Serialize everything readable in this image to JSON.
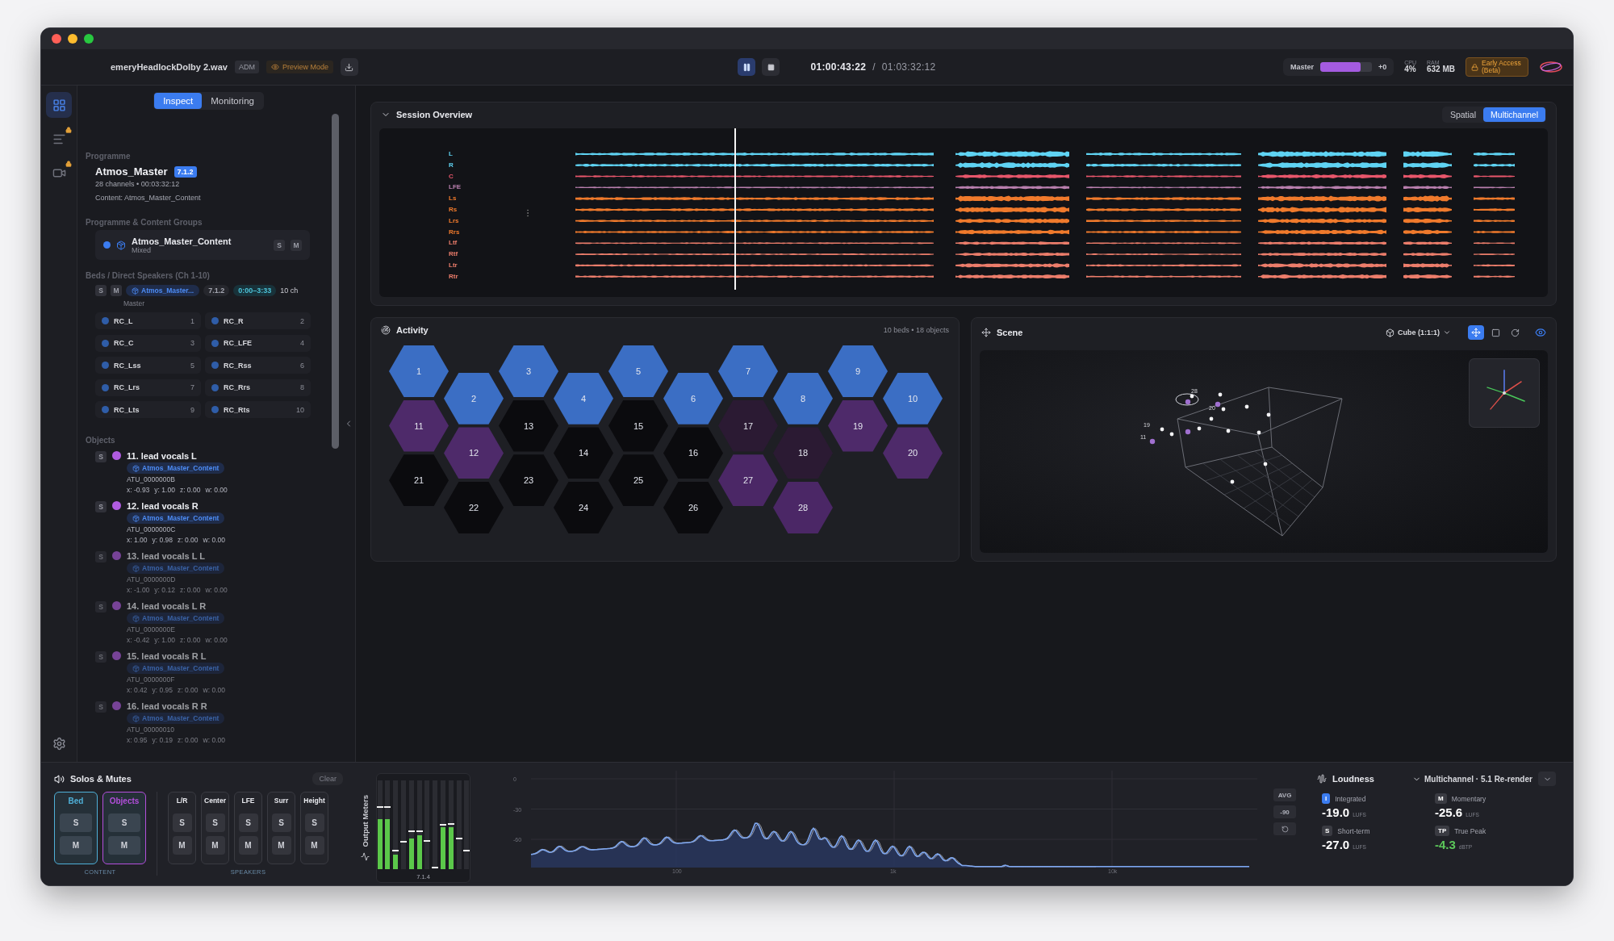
{
  "toolbar": {
    "filename": "emeryHeadlockDolby 2.wav",
    "format": "ADM",
    "mode": "Preview Mode",
    "playing": true,
    "timecode": "01:00:43:22",
    "separator": "/",
    "duration": "01:03:32:12",
    "master": {
      "label": "Master",
      "level": 0.78,
      "gain": "+0"
    },
    "stats": [
      {
        "label": "CPU",
        "value": "4%"
      },
      {
        "label": "RAM",
        "value": "632 MB"
      }
    ],
    "badge": "Early Access (Beta)"
  },
  "rail": [
    {
      "kind": "grid",
      "selected": true,
      "locked": false
    },
    {
      "kind": "list",
      "selected": false,
      "locked": true
    },
    {
      "kind": "video",
      "selected": false,
      "locked": true
    }
  ],
  "panel": {
    "tabs": [
      {
        "label": "Inspect",
        "selected": true
      },
      {
        "label": "Monitoring",
        "selected": false
      }
    ],
    "programme": {
      "heading": "Programme",
      "name": "Atmos_Master",
      "format": "7.1.2",
      "info": "28 channels • 00:03:32:12",
      "content": "Content: Atmos_Master_Content"
    },
    "groups": {
      "heading": "Programme & Content Groups",
      "name": "Atmos_Master_Content",
      "mix": "Mixed",
      "solo": "S",
      "mute": "M"
    },
    "beds": {
      "heading": "Beds / Direct Speakers (Ch 1-10)",
      "solo": "S",
      "mute": "M",
      "group": "Atmos_Master...",
      "format": "7.1.2",
      "range": "0:00–3:33",
      "count": "10 ch",
      "name": "Master",
      "channels": [
        {
          "name": "RC_L",
          "number": "1"
        },
        {
          "name": "RC_R",
          "number": "2"
        },
        {
          "name": "RC_C",
          "number": "3"
        },
        {
          "name": "RC_LFE",
          "number": "4"
        },
        {
          "name": "RC_Lss",
          "number": "5"
        },
        {
          "name": "RC_Rss",
          "number": "6"
        },
        {
          "name": "RC_Lrs",
          "number": "7"
        },
        {
          "name": "RC_Rrs",
          "number": "8"
        },
        {
          "name": "RC_Lts",
          "number": "9"
        },
        {
          "name": "RC_Rts",
          "number": "10"
        }
      ]
    },
    "objects_heading": "Objects",
    "objects": [
      {
        "solo": "S",
        "title": "11. lead vocals L",
        "group": "Atmos_Master_Content",
        "id": "ATU_0000000B",
        "coords": [
          "x: -0.93",
          "y: 1.00",
          "z: 0.00",
          "w: 0.00"
        ],
        "active": true
      },
      {
        "solo": "S",
        "title": "12. lead vocals R",
        "group": "Atmos_Master_Content",
        "id": "ATU_0000000C",
        "coords": [
          "x: 1.00",
          "y: 0.98",
          "z: 0.00",
          "w: 0.00"
        ],
        "active": true
      },
      {
        "solo": "S",
        "title": "13. lead vocals L L",
        "group": "Atmos_Master_Content",
        "id": "ATU_0000000D",
        "coords": [
          "x: -1.00",
          "y: 0.12",
          "z: 0.00",
          "w: 0.00"
        ],
        "active": false
      },
      {
        "solo": "S",
        "title": "14. lead vocals L R",
        "group": "Atmos_Master_Content",
        "id": "ATU_0000000E",
        "coords": [
          "x: -0.42",
          "y: 1.00",
          "z: 0.00",
          "w: 0.00"
        ],
        "active": false
      },
      {
        "solo": "S",
        "title": "15. lead vocals R L",
        "group": "Atmos_Master_Content",
        "id": "ATU_0000000F",
        "coords": [
          "x: 0.42",
          "y: 0.95",
          "z: 0.00",
          "w: 0.00"
        ],
        "active": false
      },
      {
        "solo": "S",
        "title": "16. lead vocals R R",
        "group": "Atmos_Master_Content",
        "id": "ATU_00000010",
        "coords": [
          "x: 0.95",
          "y: 0.19",
          "z: 0.00",
          "w: 0.00"
        ],
        "active": false
      }
    ]
  },
  "session": {
    "title": "Session Overview",
    "views": [
      {
        "label": "Spatial",
        "selected": false
      },
      {
        "label": "Multichannel",
        "selected": true
      }
    ],
    "playback_position": {
      "level": 0.2
    },
    "channels": [
      {
        "label": "L",
        "color": "#5fd3f3"
      },
      {
        "label": "R",
        "color": "#5fd3f3"
      },
      {
        "label": "C",
        "color": "#e8566b"
      },
      {
        "label": "LFE",
        "color": "#b97fae"
      },
      {
        "label": "Ls",
        "color": "#f07a2c"
      },
      {
        "label": "Rs",
        "color": "#f07a2c"
      },
      {
        "label": "Lrs",
        "color": "#f07a2c"
      },
      {
        "label": "Rrs",
        "color": "#f07a2c"
      },
      {
        "label": "Ltf",
        "color": "#ec7d6b"
      },
      {
        "label": "Rtf",
        "color": "#ec7d6b"
      },
      {
        "label": "Ltr",
        "color": "#ec7d6b"
      },
      {
        "label": "Rtr",
        "color": "#ec7d6b"
      }
    ]
  },
  "activity": {
    "title": "Activity",
    "summary": "10 beds • 18 objects",
    "cells": [
      {
        "label": "1",
        "color": "#3b6ec4"
      },
      {
        "label": "2",
        "color": "#3b6ec4"
      },
      {
        "label": "3",
        "color": "#3b6ec4"
      },
      {
        "label": "4",
        "color": "#3b6ec4"
      },
      {
        "label": "5",
        "color": "#3b6ec4"
      },
      {
        "label": "6",
        "color": "#3b6ec4"
      },
      {
        "label": "7",
        "color": "#3b6ec4"
      },
      {
        "label": "8",
        "color": "#3b6ec4"
      },
      {
        "label": "9",
        "color": "#3b6ec4"
      },
      {
        "label": "10",
        "color": "#3b6ec4"
      },
      {
        "label": "11",
        "color": "#4e2a6a"
      },
      {
        "label": "12",
        "color": "#4e2a6a"
      },
      {
        "label": "13",
        "color": "#0b0b0e"
      },
      {
        "label": "14",
        "color": "#0b0b0e"
      },
      {
        "label": "15",
        "color": "#0b0b0e"
      },
      {
        "label": "16",
        "color": "#0b0b0e"
      },
      {
        "label": "17",
        "color": "#2b1a33"
      },
      {
        "label": "18",
        "color": "#2b1a33"
      },
      {
        "label": "19",
        "color": "#4e2a6a"
      },
      {
        "label": "20",
        "color": "#4e2a6a"
      },
      {
        "label": "21",
        "color": "#0b0b0e"
      },
      {
        "label": "22",
        "color": "#0b0b0e"
      },
      {
        "label": "23",
        "color": "#0b0b0e"
      },
      {
        "label": "24",
        "color": "#0b0b0e"
      },
      {
        "label": "25",
        "color": "#0b0b0e"
      },
      {
        "label": "26",
        "color": "#0b0b0e"
      },
      {
        "label": "27",
        "color": "#4b2766"
      },
      {
        "label": "28",
        "color": "#4b2766"
      }
    ]
  },
  "scene": {
    "title": "Scene",
    "view": "Cube (1:1:1)",
    "tools": [
      {
        "kind": "move",
        "selected": true
      },
      {
        "kind": "frame",
        "selected": false
      },
      {
        "kind": "rotate",
        "selected": false
      }
    ],
    "visible": true,
    "point_labels": [
      "28",
      "20",
      "19",
      "11"
    ]
  },
  "solos": {
    "title": "Solos & Mutes",
    "clear": "Clear",
    "content": [
      {
        "label": "Bed",
        "color": "#4fb0d8",
        "solo": "S",
        "mute": "M"
      },
      {
        "label": "Objects",
        "color": "#b34fdc",
        "solo": "S",
        "mute": "M"
      }
    ],
    "content_caption": "CONTENT",
    "speakers": [
      {
        "label": "L/R",
        "solo": "S",
        "mute": "M"
      },
      {
        "label": "Center",
        "solo": "S",
        "mute": "M"
      },
      {
        "label": "LFE",
        "solo": "S",
        "mute": "M"
      },
      {
        "label": "Surr",
        "solo": "S",
        "mute": "M"
      },
      {
        "label": "Height",
        "solo": "S",
        "mute": "M"
      }
    ],
    "speakers_caption": "SPEAKERS"
  },
  "meters": {
    "title": "Output Meters",
    "layout": "7.1.4",
    "bars": [
      {
        "fill": {
          "level": 0.56
        },
        "peak": {
          "level": 0.69
        }
      },
      {
        "fill": {
          "level": 0.56
        },
        "peak": {
          "level": 0.69
        }
      },
      {
        "fill": {
          "level": 0.16
        },
        "peak": {
          "level": 0.2
        }
      },
      {
        "peak": {
          "level": 0.3
        }
      },
      {
        "fill": {
          "level": 0.35
        },
        "peak": {
          "level": 0.42
        }
      },
      {
        "fill": {
          "level": 0.38
        },
        "peak": {
          "level": 0.42
        }
      },
      {
        "peak": {
          "level": 0.31
        }
      },
      {
        "peak": {
          "level": 0.01
        }
      },
      {
        "fill": {
          "level": 0.47
        },
        "peak": {
          "level": 0.49
        }
      },
      {
        "fill": {
          "level": 0.47
        },
        "peak": {
          "level": 0.5
        }
      },
      {
        "peak": {
          "level": 0.34
        }
      },
      {
        "peak": {
          "level": 0.2
        }
      }
    ]
  },
  "spectrum": {
    "y_ticks": [
      "0",
      "-30",
      "-60"
    ],
    "x_ticks": [
      "100",
      "1k",
      "10k"
    ],
    "controls": [
      "AVG",
      "-90"
    ]
  },
  "loudness": {
    "title": "Loudness",
    "mode": "Multichannel · 5.1 Re-render",
    "readings": [
      {
        "badge": "I",
        "label": "Integrated",
        "value": "-19.0",
        "unit": "LUFS",
        "selected": true,
        "color": "#ffffff"
      },
      {
        "badge": "M",
        "label": "Momentary",
        "value": "-25.6",
        "unit": "LUFS",
        "selected": false,
        "color": "#ffffff"
      },
      {
        "badge": "S",
        "label": "Short-term",
        "value": "-27.0",
        "unit": "LUFS",
        "selected": false,
        "color": "#ffffff"
      },
      {
        "badge": "TP",
        "label": "True Peak",
        "value": "-4.3",
        "unit": "dBTP",
        "selected": false,
        "color": "#5cc85a"
      }
    ]
  }
}
